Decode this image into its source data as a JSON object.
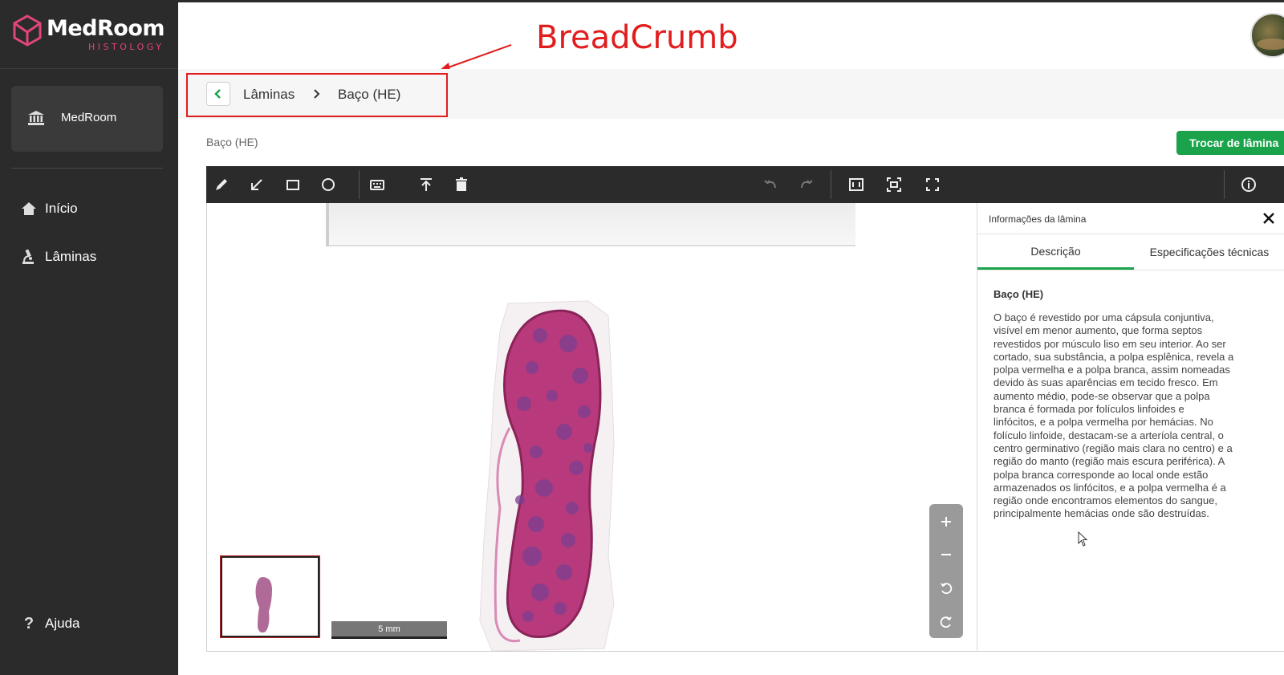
{
  "app": {
    "brand": "MedRoom",
    "brand_sub": "HISTOLOGY"
  },
  "sidebar": {
    "institution": "MedRoom",
    "items": [
      {
        "label": "Início",
        "icon": "home-icon"
      },
      {
        "label": "Lâminas",
        "icon": "microscope-icon"
      }
    ],
    "help_label": "Ajuda"
  },
  "annotation": {
    "label": "BreadCrumb",
    "color": "#e11d1d"
  },
  "breadcrumb": {
    "items": [
      "Lâminas",
      "Baço (HE)"
    ]
  },
  "page": {
    "slide_title": "Baço (HE)",
    "swap_button": "Trocar de lâmina"
  },
  "toolbar": {
    "tools": [
      "pencil-icon",
      "arrow-icon",
      "rectangle-icon",
      "circle-icon",
      "text-annotation-icon",
      "upload-icon",
      "trash-icon",
      "undo-icon",
      "redo-icon",
      "fit-area-icon",
      "center-focus-icon",
      "fullscreen-icon",
      "info-icon"
    ]
  },
  "viewer": {
    "scale_label": "5 mm",
    "zoom_controls": [
      "zoom-in-icon",
      "zoom-out-icon",
      "rotate-left-icon",
      "rotate-right-icon"
    ]
  },
  "info_panel": {
    "header": "Informações da lâmina",
    "tabs": [
      "Descrição",
      "Especificações técnicas"
    ],
    "active_tab": "Descrição",
    "desc_title": "Baço (HE)",
    "desc_lines": [
      "O baço é revestido por uma cápsula conjuntiva,",
      "visível em menor aumento, que forma septos",
      "revestidos por músculo liso em seu interior. Ao ser",
      "cortado, sua substância, a polpa esplênica, revela a",
      "polpa vermelha e a polpa branca, assim nomeadas",
      "devido às suas aparências em tecido fresco. Em",
      "aumento médio, pode-se observar que a polpa",
      "branca é formada por folículos linfoides e",
      "linfócitos, e a polpa vermelha por hemácias. No",
      "folículo linfoide, destacam-se a arteríola central, o",
      "centro germinativo (região mais clara no centro) e a",
      "região do manto (região mais escura periférica). A",
      "polpa branca corresponde ao local onde estão",
      "armazenados os linfócitos, e a polpa vermelha é a",
      "região onde encontramos elementos do sangue,",
      "principalmente hemácias onde são destruídas."
    ]
  },
  "colors": {
    "sidebar_bg": "#2b2b2b",
    "accent_green": "#1aa34a",
    "brand_pink": "#e0457b",
    "tissue_pink": "#b83a7c"
  }
}
